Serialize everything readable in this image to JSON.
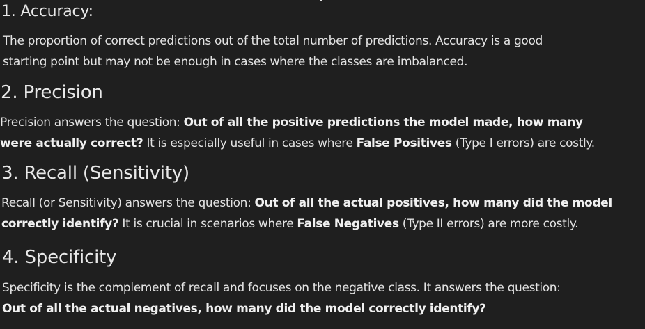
{
  "sections": [
    {
      "heading": "1. Accuracy:",
      "lines": [
        [
          {
            "t": "The proportion of correct predictions out of the total number of predictions. Accuracy is a good",
            "b": false
          }
        ],
        [
          {
            "t": "starting point but may not be enough in cases where the classes are imbalanced.",
            "b": false
          }
        ]
      ]
    },
    {
      "heading": "2. Precision",
      "lines": [
        [
          {
            "t": "Precision answers the question: ",
            "b": false
          },
          {
            "t": "Out of all the positive predictions the model made, how many",
            "b": true
          }
        ],
        [
          {
            "t": "were actually correct?",
            "b": true
          },
          {
            "t": " It is especially useful in cases where ",
            "b": false
          },
          {
            "t": "False Positives",
            "b": true
          },
          {
            "t": " (Type I errors) are costly.",
            "b": false
          }
        ]
      ]
    },
    {
      "heading": "3. Recall (Sensitivity)",
      "lines": [
        [
          {
            "t": "Recall (or Sensitivity) answers the question: ",
            "b": false
          },
          {
            "t": "Out of all the actual positives, how many did the model",
            "b": true
          }
        ],
        [
          {
            "t": "correctly identify?",
            "b": true
          },
          {
            "t": " It is crucial in scenarios where ",
            "b": false
          },
          {
            "t": "False Negatives",
            "b": true
          },
          {
            "t": " (Type II errors) are more costly.",
            "b": false
          }
        ]
      ]
    },
    {
      "heading": "4. Specificity",
      "lines": [
        [
          {
            "t": "Specificity is the complement of recall and focuses on the negative class. It answers the question:",
            "b": false
          }
        ],
        [
          {
            "t": "Out of all the actual negatives, how many did the model correctly identify?",
            "b": true
          }
        ]
      ]
    }
  ]
}
